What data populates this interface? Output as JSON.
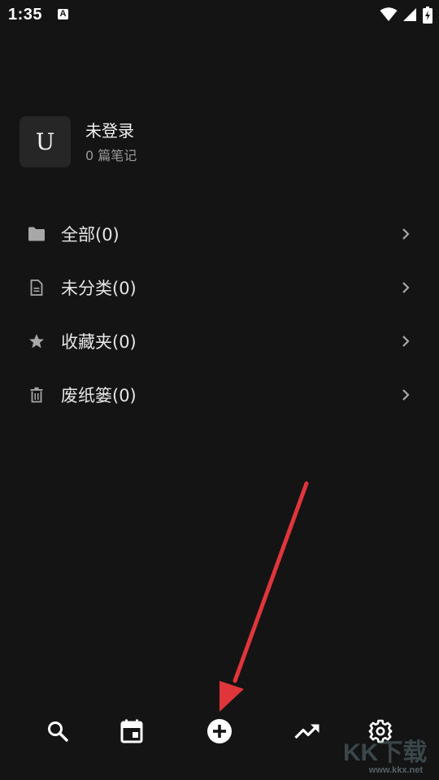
{
  "status_bar": {
    "time": "1:35",
    "notification_icon": "a-letter-icon",
    "indicators": [
      "wifi-icon",
      "cell-signal-icon",
      "battery-charging-icon"
    ]
  },
  "profile": {
    "avatar_letter": "U",
    "name": "未登录",
    "note_count": "0 篇笔记"
  },
  "folders": [
    {
      "icon": "folder-icon",
      "label": "全部(0)"
    },
    {
      "icon": "document-icon",
      "label": "未分类(0)"
    },
    {
      "icon": "star-icon",
      "label": "收藏夹(0)"
    },
    {
      "icon": "trash-icon",
      "label": "废纸篓(0)"
    }
  ],
  "bottom_nav": [
    "search-icon",
    "calendar-icon",
    "add-circle-icon",
    "trending-icon",
    "settings-icon"
  ],
  "colors": {
    "background": "#141414",
    "avatar_bg": "#262626",
    "text_primary": "#e6e6e6",
    "text_secondary": "#9a9a9a",
    "icon": "#a8a8a8",
    "annotation_arrow": "#e0353a"
  },
  "watermark": {
    "text": "www.kkx.net"
  }
}
